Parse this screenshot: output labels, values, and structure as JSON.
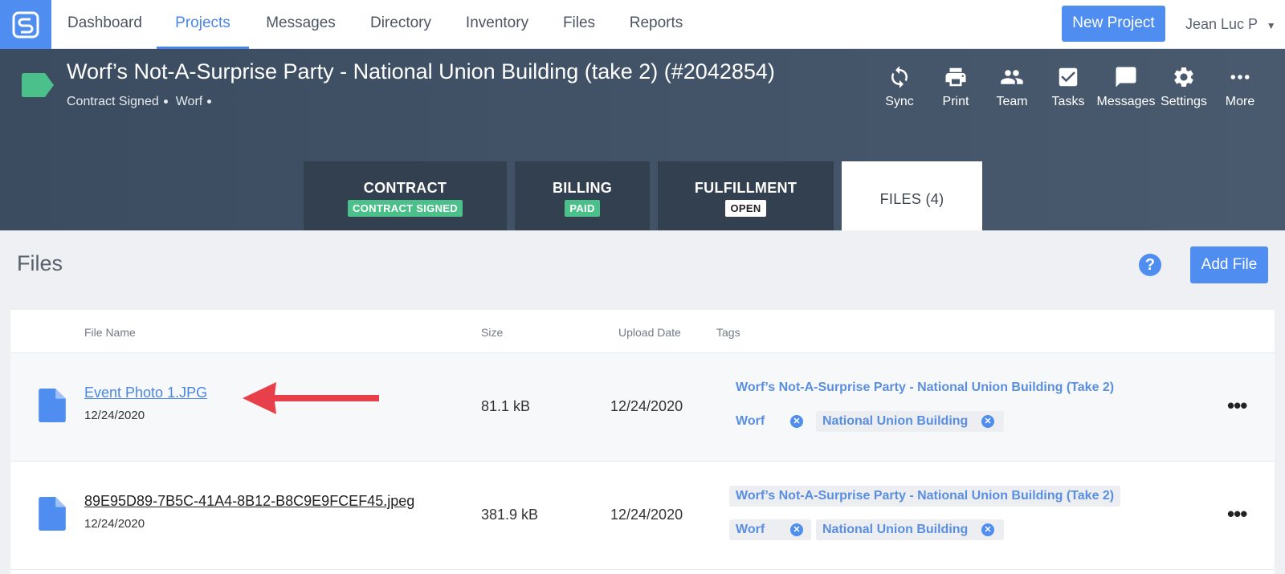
{
  "nav": {
    "items": [
      {
        "label": "Dashboard",
        "active": false
      },
      {
        "label": "Projects",
        "active": true
      },
      {
        "label": "Messages",
        "active": false
      },
      {
        "label": "Directory",
        "active": false
      },
      {
        "label": "Inventory",
        "active": false
      },
      {
        "label": "Files",
        "active": false
      },
      {
        "label": "Reports",
        "active": false
      }
    ],
    "new_project_label": "New Project",
    "user_label": "Jean Luc P"
  },
  "project": {
    "title": "Worf’s Not-A-Surprise Party - National Union Building (take 2) (#2042854)",
    "status": "Contract Signed",
    "owner": "Worf",
    "tag_color": "#4cc08a"
  },
  "actions": [
    {
      "label": "Sync",
      "icon": "sync-icon"
    },
    {
      "label": "Print",
      "icon": "print-icon"
    },
    {
      "label": "Team",
      "icon": "team-icon"
    },
    {
      "label": "Tasks",
      "icon": "tasks-icon"
    },
    {
      "label": "Messages",
      "icon": "messages-icon"
    },
    {
      "label": "Settings",
      "icon": "settings-icon"
    },
    {
      "label": "More",
      "icon": "more-icon"
    }
  ],
  "tabs": [
    {
      "label": "CONTRACT",
      "badge": "CONTRACT SIGNED",
      "badge_color": "#4cc08a"
    },
    {
      "label": "BILLING",
      "badge": "PAID",
      "badge_color": "#4cc08a"
    },
    {
      "label": "FULFILLMENT",
      "badge": "OPEN",
      "badge_color": "#ffffff"
    },
    {
      "label": "FILES (4)",
      "active": true
    }
  ],
  "files_section": {
    "title": "Files",
    "help_glyph": "?",
    "add_file_label": "Add File"
  },
  "table": {
    "headers": {
      "name": "File Name",
      "size": "Size",
      "upload_date": "Upload Date",
      "tags": "Tags"
    },
    "rows": [
      {
        "name": "Event Photo 1.JPG",
        "date": "12/24/2020",
        "size": "81.1 kB",
        "upload_date": "12/24/2020",
        "tags": [
          "Worf’s Not-A-Surprise Party - National Union Building (Take 2)",
          "Worf",
          "National Union Building"
        ]
      },
      {
        "name": "89E95D89-7B5C-41A4-8B12-B8C9E9FCEF45.jpeg",
        "date": "12/24/2020",
        "size": "381.9 kB",
        "upload_date": "12/24/2020",
        "tags": [
          "Worf’s Not-A-Surprise Party - National Union Building (Take 2)",
          "Worf",
          "National Union Building"
        ]
      }
    ]
  },
  "colors": {
    "accent": "#4f8ef0",
    "header_bg": "#3c4c60",
    "arrow": "#e8404a"
  }
}
